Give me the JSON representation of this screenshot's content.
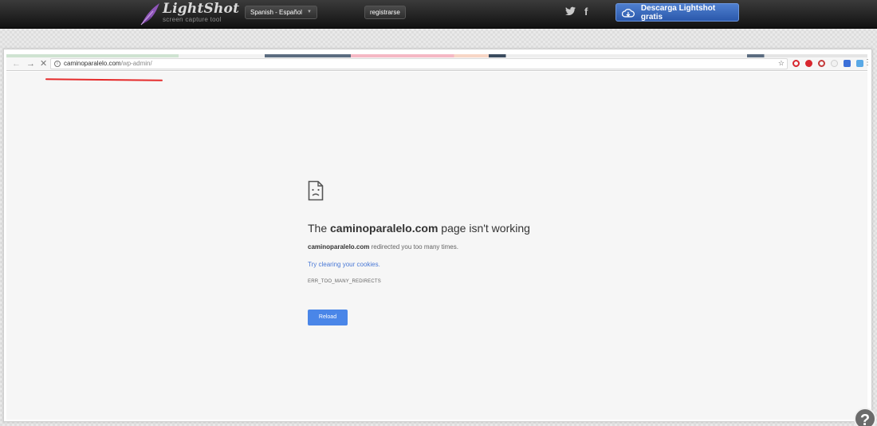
{
  "lightshot": {
    "logo_name": "LightShot",
    "logo_tagline": "screen capture tool",
    "language_label": "Spanish - Español",
    "register_label": "registrarse",
    "download_label": "Descarga Lightshot gratis",
    "social_facebook": "f"
  },
  "browser": {
    "url_host": "caminoparalelo.com",
    "url_path": "/wp-admin/"
  },
  "error": {
    "title_prefix": "The ",
    "title_domain": "caminoparalelo.com",
    "title_suffix": " page isn't working",
    "detail_domain": "caminoparalelo.com",
    "detail_text": " redirected you too many times.",
    "suggestion_prefix": "Try ",
    "suggestion_link": "clearing your cookies",
    "suggestion_suffix": ".",
    "code": "ERR_TOO_MANY_REDIRECTS",
    "reload_label": "Reload"
  },
  "help_label": "?",
  "colors": {
    "topbar": "#111111",
    "download_button": "#3568c0",
    "reload_button": "#4a86e8",
    "link": "#4a79d6",
    "annotation": "#e52b2b"
  }
}
